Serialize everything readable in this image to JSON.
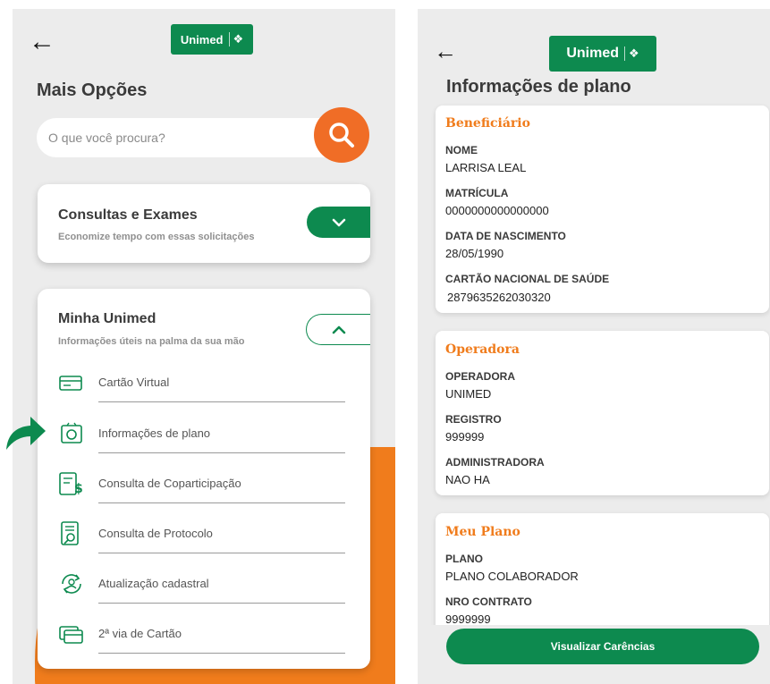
{
  "brand": {
    "logo_text": "Unimed",
    "green": "#0d8a4f",
    "orange": "#f07c1c"
  },
  "left": {
    "title": "Mais Opções",
    "search": {
      "placeholder": "O que você procura?"
    },
    "consultas": {
      "title": "Consultas e Exames",
      "subtitle": "Economize tempo com essas solicitações",
      "state": "collapsed"
    },
    "minha_unimed": {
      "title": "Minha Unimed",
      "subtitle": "Informações úteis na palma da sua mão",
      "state": "expanded",
      "items": [
        {
          "label": "Cartão Virtual",
          "icon": "card-icon"
        },
        {
          "label": "Informações de plano",
          "icon": "plan-info-icon"
        },
        {
          "label": "Consulta de Coparticipação",
          "icon": "coparticipation-icon"
        },
        {
          "label": "Consulta de Protocolo",
          "icon": "protocol-icon"
        },
        {
          "label": "Atualização cadastral",
          "icon": "update-profile-icon"
        },
        {
          "label": "2ª via de Cartão",
          "icon": "card-copy-icon"
        }
      ]
    }
  },
  "right": {
    "title": "Informações de plano",
    "beneficiario": {
      "title": "Beneficiário",
      "fields": [
        {
          "label": "NOME",
          "value": "LARRISA LEAL"
        },
        {
          "label": "MATRÍCULA",
          "value": "0000000000000000"
        },
        {
          "label": "DATA DE NASCIMENTO",
          "value": "28/05/1990"
        },
        {
          "label": "CARTÃO NACIONAL DE SAÚDE",
          "value": "2879635262030320"
        }
      ]
    },
    "operadora": {
      "title": "Operadora",
      "fields": [
        {
          "label": "OPERADORA",
          "value": "UNIMED"
        },
        {
          "label": "REGISTRO",
          "value": "999999"
        },
        {
          "label": "ADMINISTRADORA",
          "value": "NAO HA"
        }
      ]
    },
    "meu_plano": {
      "title": "Meu Plano",
      "fields": [
        {
          "label": "PLANO",
          "value": "PLANO COLABORADOR"
        },
        {
          "label": "NRO CONTRATO",
          "value": "9999999"
        }
      ]
    },
    "cta_label": "Visualizar Carências"
  }
}
